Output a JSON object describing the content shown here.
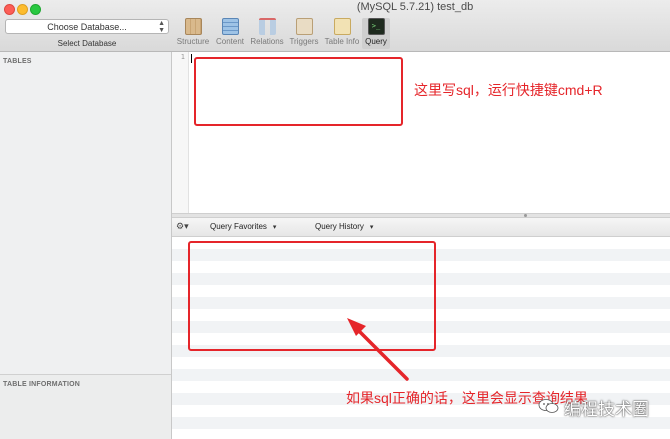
{
  "window": {
    "title": "(MySQL 5.7.21) test_db"
  },
  "database_selector": {
    "value": "Choose Database...",
    "label": "Select Database"
  },
  "toolbar": {
    "buttons": [
      {
        "label": "Structure",
        "icon": "structure-icon"
      },
      {
        "label": "Content",
        "icon": "content-icon"
      },
      {
        "label": "Relations",
        "icon": "relations-icon"
      },
      {
        "label": "Triggers",
        "icon": "triggers-icon"
      },
      {
        "label": "Table Info",
        "icon": "table-info-icon"
      },
      {
        "label": "Query",
        "icon": "query-icon",
        "active": true
      }
    ]
  },
  "sidebar": {
    "tables_header": "TABLES",
    "info_header": "TABLE INFORMATION"
  },
  "editor": {
    "line_number": "1",
    "content": ""
  },
  "results_bar": {
    "gear": "⚙▾",
    "favorites": "Query Favorites",
    "history": "Query History"
  },
  "annotations": {
    "editor_note": "这里写sql，运行快捷键cmd+R",
    "results_note": "如果sql正确的话，这里会显示查询结果",
    "color": "#e5252a"
  },
  "watermark": {
    "text": "编程技术圈",
    "icon": "wechat-icon"
  }
}
